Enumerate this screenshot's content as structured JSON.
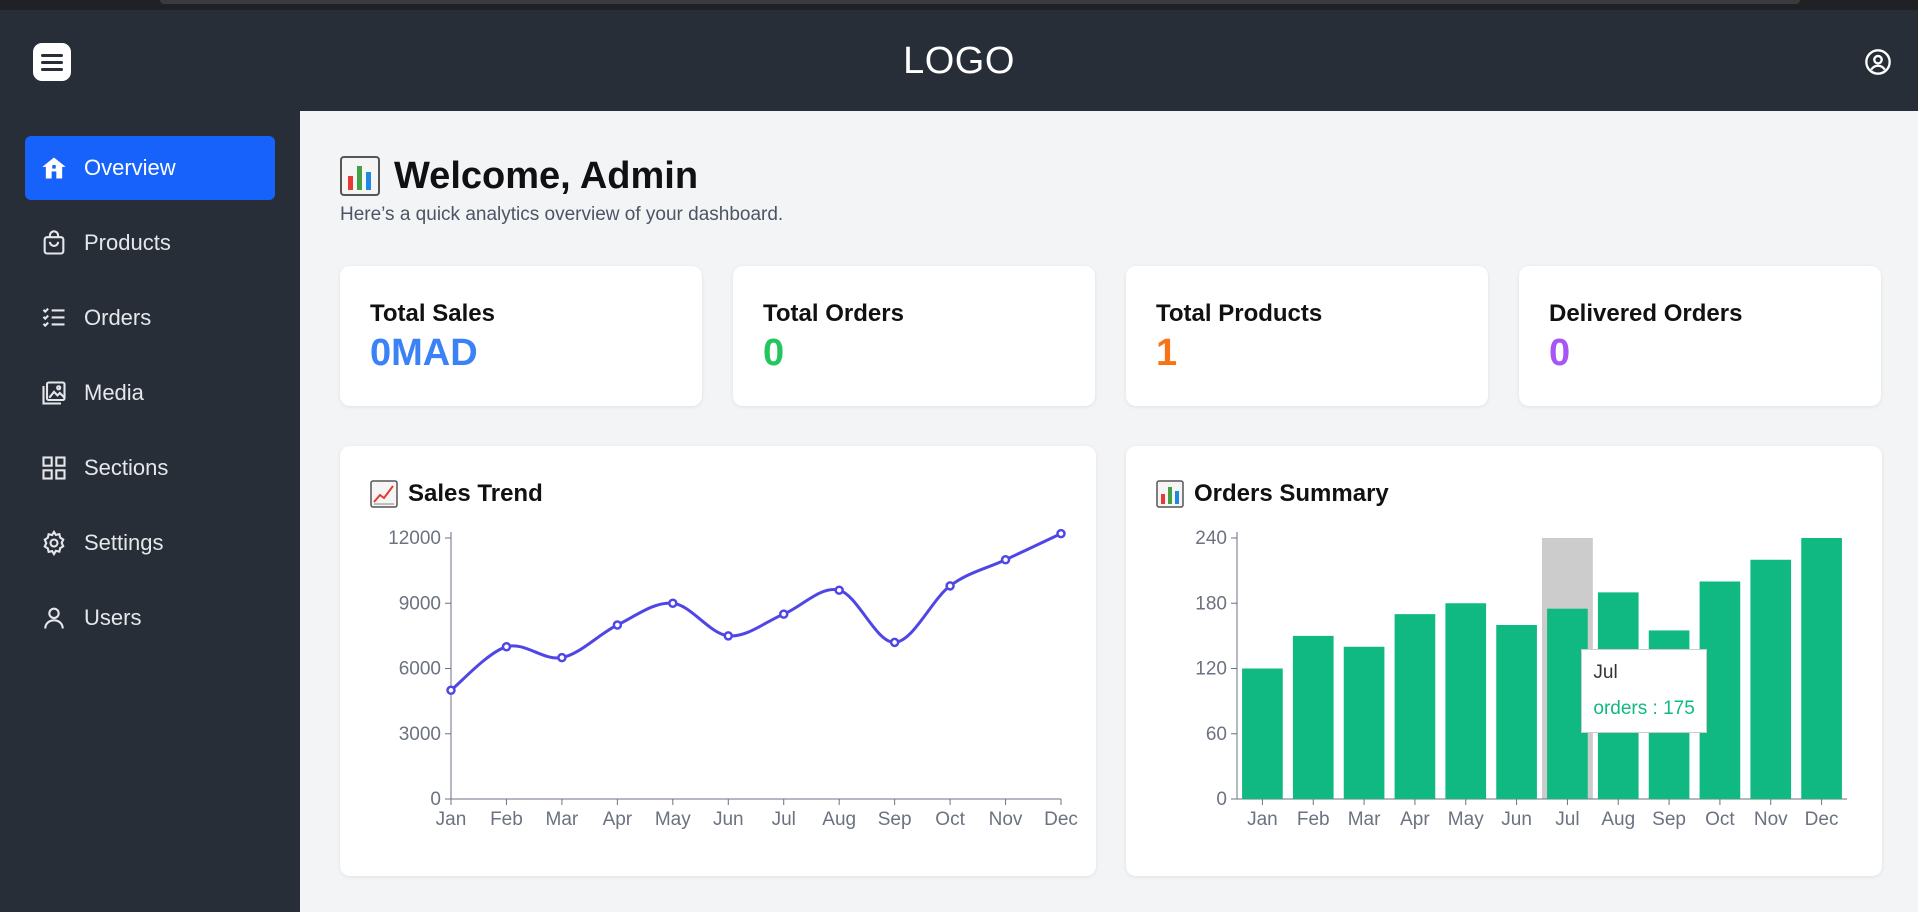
{
  "header": {
    "logo": "LOGO",
    "menu_icon": "hamburger-menu-icon",
    "user_icon": "user-circle-icon"
  },
  "sidebar": {
    "items": [
      {
        "label": "Overview",
        "icon": "home-icon",
        "active": true
      },
      {
        "label": "Products",
        "icon": "shopping-bag-icon",
        "active": false
      },
      {
        "label": "Orders",
        "icon": "checklist-icon",
        "active": false
      },
      {
        "label": "Media",
        "icon": "images-icon",
        "active": false
      },
      {
        "label": "Sections",
        "icon": "grid-icon",
        "active": false
      },
      {
        "label": "Settings",
        "icon": "gear-icon",
        "active": false
      },
      {
        "label": "Users",
        "icon": "user-icon",
        "active": false
      }
    ]
  },
  "main": {
    "title": "Welcome, Admin",
    "subtitle": "Here’s a quick analytics overview of your dashboard."
  },
  "cards": [
    {
      "label": "Total Sales",
      "value": "0MAD",
      "color": "#3b82f6"
    },
    {
      "label": "Total Orders",
      "value": "0",
      "color": "#22c55e"
    },
    {
      "label": "Total Products",
      "value": "1",
      "color": "#f97316"
    },
    {
      "label": "Delivered Orders",
      "value": "0",
      "color": "#a855f7"
    }
  ],
  "colors": {
    "accent": "#1662fb",
    "line": "#4f46e5",
    "bar": "#10b981",
    "highlight": "#cccccc"
  },
  "chart_data": [
    {
      "type": "line",
      "title": "Sales Trend",
      "categories": [
        "Jan",
        "Feb",
        "Mar",
        "Apr",
        "May",
        "Jun",
        "Jul",
        "Aug",
        "Sep",
        "Oct",
        "Nov",
        "Dec"
      ],
      "values": [
        5000,
        7000,
        6500,
        8000,
        9000,
        7500,
        8500,
        9600,
        7200,
        9800,
        11000,
        12200
      ],
      "ylim": [
        0,
        12000
      ],
      "yticks": [
        "0",
        "3000",
        "6000",
        "9000",
        "12000"
      ],
      "grid": false
    },
    {
      "type": "bar",
      "title": "Orders Summary",
      "categories": [
        "Jan",
        "Feb",
        "Mar",
        "Apr",
        "May",
        "Jun",
        "Jul",
        "Aug",
        "Sep",
        "Oct",
        "Nov",
        "Dec"
      ],
      "series": [
        {
          "name": "orders",
          "values": [
            120,
            150,
            140,
            170,
            180,
            160,
            175,
            190,
            155,
            200,
            220,
            240
          ]
        }
      ],
      "ylim": [
        0,
        240
      ],
      "yticks": [
        "0",
        "60",
        "120",
        "180",
        "240"
      ],
      "grid": false,
      "tooltip": {
        "label": "Jul",
        "text": "orders : 175"
      }
    }
  ]
}
